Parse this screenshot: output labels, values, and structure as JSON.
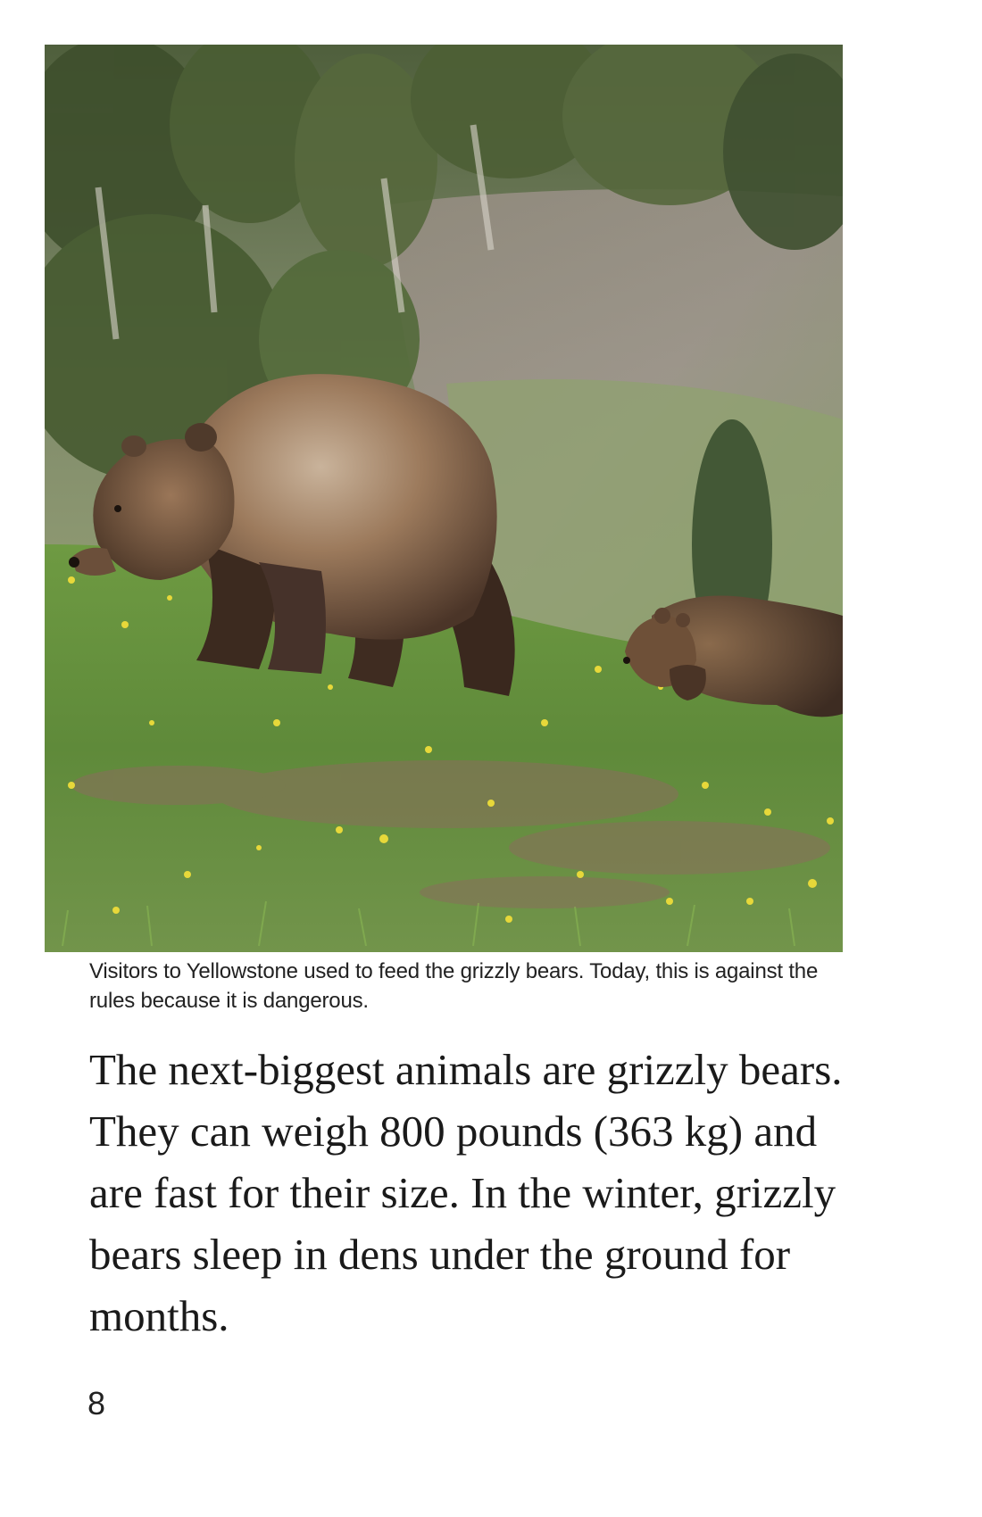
{
  "figure": {
    "image_description_icon": "grizzly-bear-with-cubs-photo",
    "caption": "Visitors to Yellowstone used to feed the grizzly bears. Today, this is against the rules because it is dangerous."
  },
  "body": {
    "paragraph": "The next-biggest animals are grizzly bears. They can weigh 800 pounds (363 kg) and are fast for their size. In the winter, grizzly bears sleep in dens under the ground for months."
  },
  "page_number": "8"
}
